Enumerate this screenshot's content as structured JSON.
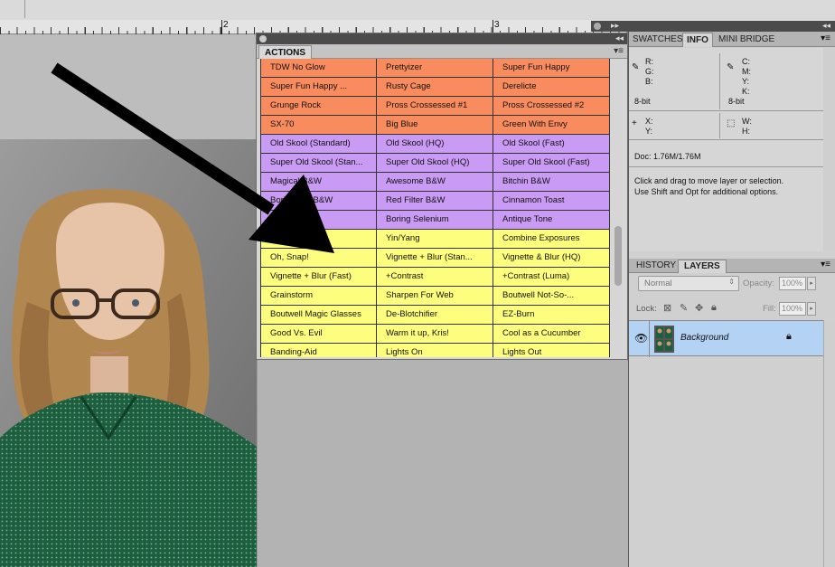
{
  "ruler": {
    "marks": [
      "2",
      "3"
    ]
  },
  "actions_panel": {
    "collapse_glyph": "◂◂",
    "tab_label": "ACTIONS",
    "menu_glyph": "▾≡",
    "colors": {
      "orange": "#f88c5e",
      "purple": "#c99bf4",
      "yellow": "#fefe7e"
    },
    "rows": [
      {
        "color": "orange",
        "cells": [
          "TDW No Glow",
          "Prettyizer",
          "Super Fun Happy"
        ]
      },
      {
        "color": "orange",
        "cells": [
          "Super Fun Happy ...",
          "Rusty Cage",
          "Derelicte"
        ]
      },
      {
        "color": "orange",
        "cells": [
          "Grunge Rock",
          "Pross Crossessed #1",
          "Pross Crossessed #2"
        ]
      },
      {
        "color": "orange",
        "cells": [
          "SX-70",
          "Big Blue",
          "Green With Envy"
        ]
      },
      {
        "color": "purple",
        "cells": [
          "Old Skool (Standard)",
          "Old Skool (HQ)",
          "Old Skool (Fast)"
        ]
      },
      {
        "color": "purple",
        "cells": [
          "Super Old Skool (Stan...",
          "Super Old Skool (HQ)",
          "Super Old Skool (Fast)"
        ]
      },
      {
        "color": "purple",
        "cells": [
          "Magical B&W",
          "Awesome B&W",
          "Bitchin B&W"
        ]
      },
      {
        "color": "purple",
        "cells": [
          "Boring Old B&W",
          "Red Filter B&W",
          "Cinnamon Toast"
        ]
      },
      {
        "color": "purple",
        "cells": [
          "Boring Sepia",
          "Boring Selenium",
          "Antique Tone"
        ]
      },
      {
        "color": "yellow",
        "cells": [
          "",
          "Yin/Yang",
          "Combine Exposures"
        ]
      },
      {
        "color": "yellow",
        "cells": [
          "Oh, Snap!",
          "Vignette + Blur (Stan...",
          "Vignette & Blur (HQ)"
        ]
      },
      {
        "color": "yellow",
        "cells": [
          "Vignette + Blur (Fast)",
          "+Contrast",
          "+Contrast (Luma)"
        ]
      },
      {
        "color": "yellow",
        "cells": [
          "Grainstorm",
          "Sharpen For Web",
          "Boutwell Not-So-..."
        ]
      },
      {
        "color": "yellow",
        "cells": [
          "Boutwell Magic Glasses",
          "De-Blotchifier",
          "EZ-Burn"
        ]
      },
      {
        "color": "yellow",
        "cells": [
          "Good Vs. Evil",
          "Warm it up, Kris!",
          "Cool as a Cucumber"
        ]
      },
      {
        "color": "yellow",
        "cells": [
          "Banding-Aid",
          "Lights On",
          "Lights Out"
        ]
      }
    ]
  },
  "info_panel": {
    "collapse_glyph": "◂◂",
    "expand_glyph": "▸▸",
    "menu_glyph": "▾≡",
    "tabs": [
      "SWATCHES",
      "INFO",
      "MINI BRIDGE"
    ],
    "active_tab": "INFO",
    "rgb": {
      "r": "R:",
      "g": "G:",
      "b": "B:",
      "bit": "8-bit"
    },
    "cmyk": {
      "c": "C:",
      "m": "M:",
      "y": "Y:",
      "k": "K:",
      "bit": "8-bit"
    },
    "xy": {
      "x": "X:",
      "y": "Y:"
    },
    "wh": {
      "w": "W:",
      "h": "H:"
    },
    "doc": "Doc: 1.76M/1.76M",
    "hint_line1": "Click and drag to move layer or selection.",
    "hint_line2": "Use Shift and Opt for additional options."
  },
  "layers_panel": {
    "tabs": [
      "HISTORY",
      "LAYERS"
    ],
    "active_tab": "LAYERS",
    "menu_glyph": "▾≡",
    "blend_mode": "Normal",
    "opacity_label": "Opacity:",
    "opacity_value": "100%",
    "lock_label": "Lock:",
    "fill_label": "Fill:",
    "fill_value": "100%",
    "layers": [
      {
        "name": "Background",
        "visible": true,
        "locked": true
      }
    ]
  }
}
